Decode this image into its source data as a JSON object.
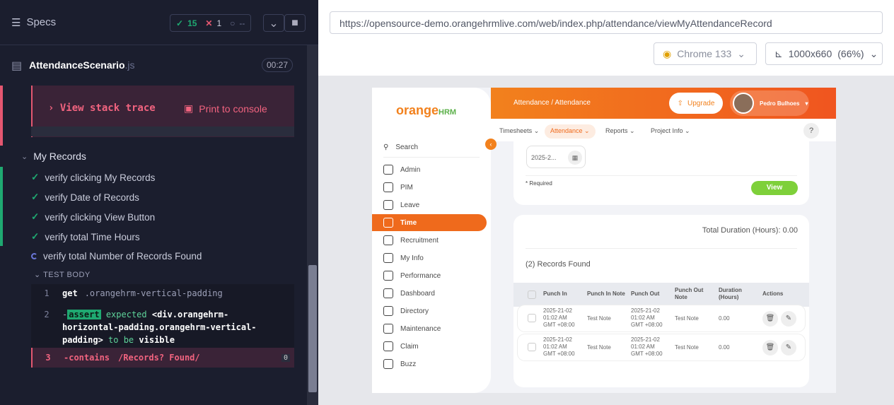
{
  "runner": {
    "specs_label": "Specs",
    "passed": "15",
    "failed": "1",
    "pending": "--",
    "file_name": "AttendanceScenario",
    "file_ext": ".js",
    "duration": "00:27",
    "stack_trace": "View stack trace",
    "print_console": "Print to console",
    "suite": "My Records",
    "tests": [
      {
        "label": "verify clicking My Records",
        "state": "passed"
      },
      {
        "label": "verify Date of Records",
        "state": "passed"
      },
      {
        "label": "verify clicking View Button",
        "state": "passed"
      },
      {
        "label": "verify total Time Hours",
        "state": "passed"
      },
      {
        "label": "verify total Number of Records Found",
        "state": "running"
      }
    ],
    "test_body": "TEST BODY",
    "cmd1": {
      "num": "1",
      "name": "get",
      "arg": ".orangehrm-vertical-padding"
    },
    "cmd2": {
      "num": "2",
      "name": "assert",
      "l1a": "expected",
      "l1b": "<div.orangehrm-",
      "l2": "horizontal-padding.orangehrm-vertical-",
      "l3a": "padding>",
      "l3b": "to be",
      "l3c": "visible"
    },
    "cmd3": {
      "num": "3",
      "name": "-contains",
      "arg": "/Records? Found/",
      "badge": "0"
    }
  },
  "browser": {
    "url": "https://opensource-demo.orangehrmlive.com/web/index.php/attendance/viewMyAttendanceRecord",
    "browser": "Chrome 133",
    "viewport": "1000x660",
    "zoom": "(66%)"
  },
  "app": {
    "logo_a": "orange",
    "logo_b": "HRM",
    "breadcrumb": "Attendance / Attendance",
    "upgrade": "Upgrade",
    "user": "Pedro Bulhoes",
    "nav": [
      "Search",
      "Admin",
      "PIM",
      "Leave",
      "Time",
      "Recruitment",
      "My Info",
      "Performance",
      "Dashboard",
      "Directory",
      "Maintenance",
      "Claim",
      "Buzz"
    ],
    "tabs": [
      "Timesheets",
      "Attendance",
      "Reports",
      "Project Info"
    ],
    "help": "?",
    "date": "2025-2...",
    "required": "* Required",
    "view": "View",
    "total": "Total Duration (Hours): 0.00",
    "found": "(2) Records Found",
    "headers": [
      "Punch In",
      "Punch In Note",
      "Punch Out",
      "Punch Out Note",
      "Duration (Hours)",
      "Actions"
    ],
    "rows": [
      {
        "in_date": "2025-21-02",
        "in_time": "01:02 AM",
        "in_tz": "GMT +08:00",
        "in_note": "Test Note",
        "out_date": "2025-21-02",
        "out_time": "01:02 AM",
        "out_tz": "GMT +08:00",
        "out_note": "Test Note",
        "dur": "0.00"
      },
      {
        "in_date": "2025-21-02",
        "in_time": "01:02 AM",
        "in_tz": "GMT +08:00",
        "in_note": "Test Note",
        "out_date": "2025-21-02",
        "out_time": "01:02 AM",
        "out_tz": "GMT +08:00",
        "out_note": "Test Note",
        "dur": "0.00"
      }
    ]
  }
}
